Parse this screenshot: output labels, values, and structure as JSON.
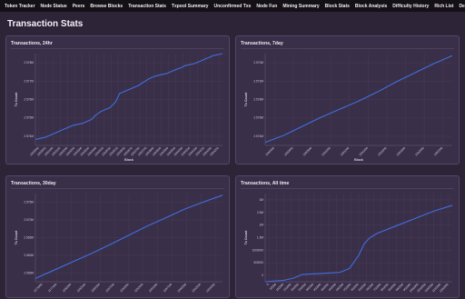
{
  "nav": {
    "items": [
      "Token Tracker",
      "Node Status",
      "Peers",
      "Browse Blocks",
      "Transaction Stats",
      "Txpool Summary",
      "Unconfirmed Txs",
      "Node Fun",
      "Mining Summary",
      "Block Stats",
      "Block Analysis",
      "Difficulty History",
      "Rich List",
      "Decoder"
    ]
  },
  "page": {
    "title": "Transaction Stats"
  },
  "colors": {
    "line": "#3f6fe0",
    "grid": "#4a3d5c",
    "panel": "#3a2f48",
    "background": "#2e2438"
  },
  "panels": [
    {
      "title": "Transactions, 24hr"
    },
    {
      "title": "Transactions, 7day"
    },
    {
      "title": "Transactions, 30day"
    },
    {
      "title": "Transactions, All time"
    }
  ],
  "chart_data": [
    {
      "type": "line",
      "title": "Transactions, 24hr",
      "xlabel": "Block",
      "ylabel": "Tx Count",
      "yticks": [
        "2.574M",
        "2.575M",
        "2.576M",
        "2.577M",
        "2.578M"
      ],
      "ylim": [
        2.5738,
        2.5784
      ],
      "xticks": [
        "1203000",
        "1203050",
        "1203100",
        "1203150",
        "1203200",
        "1203250",
        "1203300",
        "1203350",
        "1203400",
        "1203450",
        "1203500",
        "1203550",
        "1203600",
        "1203650",
        "1203700",
        "1203750",
        "1203800",
        "1203850",
        "1203900",
        "1203950",
        "1204000",
        "1204050",
        "1204100",
        "1204150",
        "1204200",
        "1204250"
      ],
      "xlim": [
        0,
        1
      ],
      "series": [
        {
          "x": [
            0.0,
            0.05,
            0.1,
            0.15,
            0.2,
            0.25,
            0.3,
            0.32,
            0.35,
            0.4,
            0.43,
            0.45,
            0.5,
            0.55,
            0.6,
            0.62,
            0.65,
            0.7,
            0.75,
            0.78,
            0.8,
            0.85,
            0.9,
            0.95,
            1.0
          ],
          "y": [
            2.5741,
            2.5742,
            2.5744,
            2.5746,
            2.5748,
            2.5749,
            2.5751,
            2.5753,
            2.5755,
            2.5757,
            2.576,
            2.5764,
            2.5766,
            2.5768,
            2.5771,
            2.5772,
            2.5773,
            2.5774,
            2.5776,
            2.5777,
            2.5778,
            2.5779,
            2.5781,
            2.5783,
            2.5784
          ]
        }
      ]
    },
    {
      "type": "line",
      "title": "Transactions, 7day",
      "xlabel": "Block",
      "ylabel": "Tx Count",
      "yticks": [
        "2.574M",
        "2.576M",
        "2.578M",
        "2.572M",
        "2.570M"
      ],
      "ylim": [
        2.5695,
        2.5786
      ],
      "xticks": [
        "1200400",
        "1200600",
        "1200800",
        "1201000",
        "1201200",
        "1201400",
        "1201600",
        "1201800",
        "1202000",
        "1202200"
      ],
      "xlim": [
        0,
        1
      ],
      "series": [
        {
          "x": [
            0.0,
            0.1,
            0.2,
            0.3,
            0.4,
            0.5,
            0.6,
            0.7,
            0.8,
            0.9,
            1.0
          ],
          "y": [
            2.5698,
            2.5705,
            2.5714,
            2.5723,
            2.5731,
            2.5739,
            2.5748,
            2.5758,
            2.5767,
            2.5776,
            2.5784
          ]
        }
      ]
    },
    {
      "type": "line",
      "title": "Transactions, 30day",
      "xlabel": "",
      "ylabel": "Tx Count",
      "yticks": [
        "2.555M",
        "2.560M",
        "2.565M",
        "2.570M",
        "2.575M"
      ],
      "ylim": [
        2.5525,
        2.579
      ],
      "xticks": [
        "1175000",
        "1177500",
        "1180000",
        "1182500",
        "1185000",
        "1187500",
        "1190000",
        "1192500",
        "1195000",
        "1197500",
        "1200000",
        "1202500",
        "1205000"
      ],
      "xlim": [
        0,
        1
      ],
      "series": [
        {
          "x": [
            0.0,
            0.1,
            0.2,
            0.3,
            0.4,
            0.5,
            0.6,
            0.7,
            0.8,
            0.9,
            1.0
          ],
          "y": [
            2.5535,
            2.556,
            2.5585,
            2.561,
            2.5637,
            2.5665,
            2.5693,
            2.5718,
            2.5744,
            2.5765,
            2.5785
          ]
        }
      ]
    },
    {
      "type": "line",
      "title": "Transactions, All time",
      "xlabel": "",
      "ylabel": "Tx Count",
      "yticks": [
        "0",
        "500000",
        "1000000",
        "1.5M",
        "2M",
        "2.5M",
        "3M"
      ],
      "ylim": [
        0,
        3000000
      ],
      "xticks": [
        "0",
        "50000",
        "100000",
        "150000",
        "200000",
        "250000",
        "300000",
        "350000",
        "400000",
        "450000",
        "500000",
        "550000",
        "600000",
        "650000",
        "700000",
        "750000",
        "800000",
        "850000",
        "900000",
        "950000",
        "1000000",
        "1050000",
        "1100000",
        "1150000",
        "1200000"
      ],
      "xlim": [
        0,
        1
      ],
      "series": [
        {
          "x": [
            0.0,
            0.1,
            0.15,
            0.2,
            0.3,
            0.4,
            0.45,
            0.5,
            0.53,
            0.56,
            0.6,
            0.7,
            0.8,
            0.9,
            1.0
          ],
          "y": [
            0,
            50000,
            120000,
            250000,
            280000,
            320000,
            450000,
            900000,
            1300000,
            1500000,
            1650000,
            1900000,
            2150000,
            2400000,
            2600000
          ]
        }
      ]
    }
  ]
}
